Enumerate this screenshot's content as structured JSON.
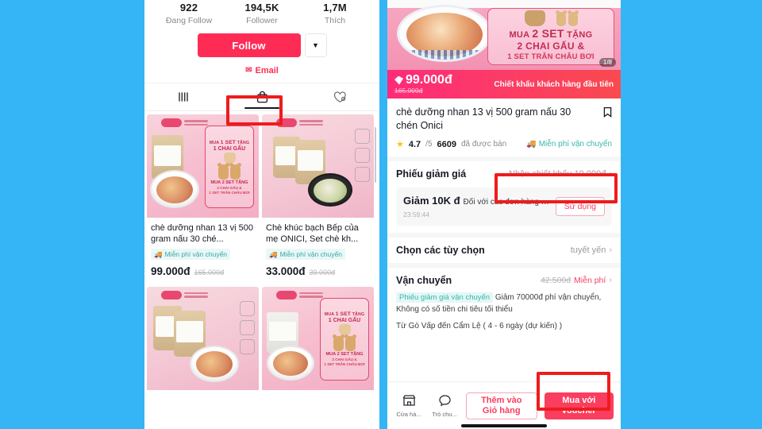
{
  "left_panel": {
    "stats": [
      {
        "num": "922",
        "label": "Đang Follow"
      },
      {
        "num": "194,5K",
        "label": "Follower"
      },
      {
        "num": "1,7M",
        "label": "Thích"
      }
    ],
    "follow_button": "Follow",
    "follow_caret_icon": "chevron-down-icon",
    "email_label": "Email",
    "email_icon": "mail-icon",
    "tabs": [
      {
        "name": "videos",
        "icon": "grid-videos-icon",
        "active": false
      },
      {
        "name": "shop",
        "icon": "shopping-bag-icon",
        "active": true
      },
      {
        "name": "liked",
        "icon": "heart-icon",
        "active": false
      }
    ],
    "products": [
      {
        "title": "chè dưỡng nhan 13 vị 500 gram nấu 30 ché...",
        "shipping": "Miễn phí vận chuyển",
        "price": "99.000đ",
        "price_old": "165.000đ",
        "promo_line1_pre": "MUA",
        "promo_line1_em": "1 SET",
        "promo_line1_post": "TẶNG",
        "promo_line2": "1 CHAI GẤU",
        "promo_line3_pre": "MUA",
        "promo_line3_em": "2 SET",
        "promo_line3_post": "TẶNG",
        "promo_line4a": "2 CHAI GẤU &",
        "promo_line4b": "1 SET TRÂN CHÂU BƠI"
      },
      {
        "title": "Chè khúc bạch Bếp của mẹ ONICI, Set chè kh...",
        "shipping": "Miễn phí vận chuyển",
        "price": "33.000đ",
        "price_old": "39.000đ"
      },
      {
        "title": "",
        "shipping": "",
        "price": "",
        "price_old": ""
      },
      {
        "title": "",
        "shipping": "",
        "price": "",
        "price_old": "",
        "promo_line1_pre": "MUA",
        "promo_line1_em": "1 SET",
        "promo_line1_post": "TẶNG",
        "promo_line2": "1 CHAI GẤU",
        "promo_line3_pre": "MUA",
        "promo_line3_em": "2 SET",
        "promo_line3_post": "TẶNG",
        "promo_line4a": "2 CHAI GẤU &",
        "promo_line4b": "1 SET TRÂN CHÂU BƠI"
      }
    ]
  },
  "right_panel": {
    "hero": {
      "promo_line1_pre": "MUA",
      "promo_line1_em": "2 SET",
      "promo_line1_post": "TẶNG",
      "promo_line2": "2 CHAI GẤU &",
      "promo_line3": "1 SET TRÂN CHÂU BƠI",
      "counter": "1/8"
    },
    "price_strip": {
      "price": "99.000đ",
      "price_old": "165.000đ",
      "note": "Chiết khấu khách hàng đầu tiên",
      "tag_icon": "discount-tag-icon"
    },
    "product": {
      "title": "chè dưỡng nhan 13 vị 500 gram nấu 30 chén Onici",
      "bookmark_icon": "bookmark-icon",
      "rating": "4.7",
      "rating_suffix": "/5",
      "sold_count": "6609",
      "sold_label": "đã được bán",
      "free_shipping": "Miễn phí vận chuyển",
      "free_shipping_icon": "truck-icon"
    },
    "voucher_section": {
      "label": "Phiếu giảm giá",
      "action": "Nhận chiết khấu 10.000đ",
      "chevron_icon": "chevron-right-icon",
      "card": {
        "amount": "Giảm 10K đ",
        "description": "Đối với các đơn hàng có giá trị t...",
        "timer": "23:59:44",
        "use_button": "Sử dụng"
      }
    },
    "options_section": {
      "label": "Chọn các tùy chọn",
      "value": "tuyết yến",
      "chevron_icon": "chevron-right-icon"
    },
    "shipping_section": {
      "label": "Vận chuyển",
      "price_old": "42.500đ",
      "price_free": "Miễn phí",
      "chevron_icon": "chevron-right-icon",
      "badge": "Phiếu giảm giá vận chuyển",
      "detail": "Giảm 70000đ phí vận chuyển, Không có số tiền chi tiêu tối thiểu",
      "route": "Từ Gò Vấp đến Cẩm Lệ ( 4 - 6 ngày (dự kiến) )"
    },
    "bottom_bar": {
      "shop_label": "Cửa hà...",
      "shop_icon": "storefront-icon",
      "chat_label": "Trò chu...",
      "chat_icon": "chat-bubble-icon",
      "add_cart_line1": "Thêm vào",
      "add_cart_line2": "Giỏ hàng",
      "buy_line1": "Mua với",
      "buy_line2": "voucher"
    }
  },
  "annotations": {
    "highlight_color": "#ee1c1c",
    "boxes": [
      {
        "name": "shop-tab-highlight"
      },
      {
        "name": "voucher-action-highlight"
      },
      {
        "name": "buy-with-voucher-highlight"
      }
    ]
  }
}
